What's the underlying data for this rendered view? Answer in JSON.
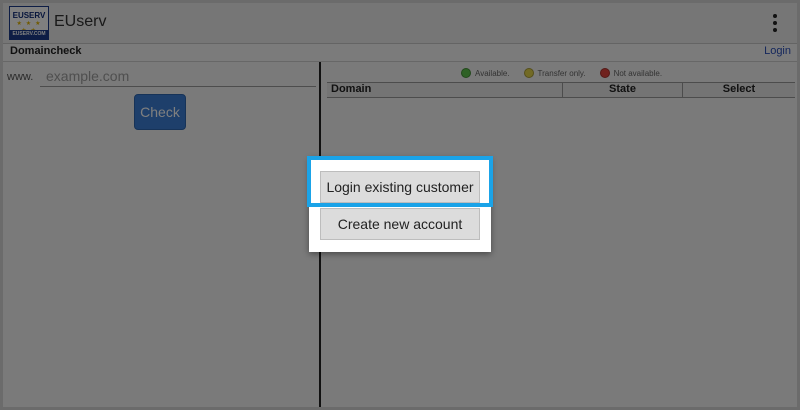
{
  "app": {
    "title": "EUserv",
    "logo": {
      "top_text": "EUSERV",
      "stars": "★ ★ ★ ★ ★",
      "bottom_text": "EUSERV.COM"
    }
  },
  "subbar": {
    "title": "Domaincheck",
    "login_label": "Login"
  },
  "search": {
    "prefix": "www.",
    "placeholder": "example.com",
    "value": "",
    "check_label": "Check"
  },
  "legend": [
    {
      "label": "Available.",
      "color": "#5cc24a"
    },
    {
      "label": "Transfer only.",
      "color": "#e5d44a"
    },
    {
      "label": "Not available.",
      "color": "#e0443c"
    }
  ],
  "table": {
    "columns": [
      "Domain",
      "State",
      "Select"
    ]
  },
  "dialog": {
    "login_label": "Login existing customer",
    "create_label": "Create new account"
  },
  "colors": {
    "accent": "#1aa3e8",
    "check_button": "#3d7fd6",
    "link": "#2a4fb8"
  }
}
